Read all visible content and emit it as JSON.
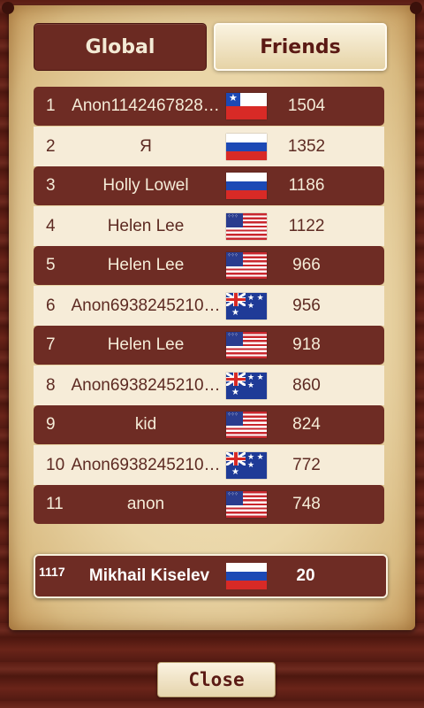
{
  "tabs": {
    "global_label": "Global",
    "friends_label": "Friends",
    "active": "global"
  },
  "leaderboard": [
    {
      "rank": "1",
      "name": "Anon1142467828…",
      "flag": "chile-flag-icon",
      "score": "1504"
    },
    {
      "rank": "2",
      "name": "Я",
      "flag": "russia-flag-icon",
      "score": "1352"
    },
    {
      "rank": "3",
      "name": "Holly Lowel",
      "flag": "russia-flag-icon",
      "score": "1186"
    },
    {
      "rank": "4",
      "name": "Helen Lee",
      "flag": "usa-flag-icon",
      "score": "1122"
    },
    {
      "rank": "5",
      "name": "Helen Lee",
      "flag": "usa-flag-icon",
      "score": "966"
    },
    {
      "rank": "6",
      "name": "Anon6938245210…",
      "flag": "australia-flag-icon",
      "score": "956"
    },
    {
      "rank": "7",
      "name": "Helen Lee",
      "flag": "usa-flag-icon",
      "score": "918"
    },
    {
      "rank": "8",
      "name": "Anon6938245210…",
      "flag": "australia-flag-icon",
      "score": "860"
    },
    {
      "rank": "9",
      "name": "kid",
      "flag": "usa-flag-icon",
      "score": "824"
    },
    {
      "rank": "10",
      "name": "Anon6938245210…",
      "flag": "australia-flag-icon",
      "score": "772"
    },
    {
      "rank": "11",
      "name": "anon",
      "flag": "usa-flag-icon",
      "score": "748"
    }
  ],
  "current_player": {
    "rank": "1117",
    "name": "Mikhail Kiselev",
    "flag": "russia-flag-icon",
    "score": "20"
  },
  "close_label": "Close",
  "colors": {
    "dark_row": "#6e2c24",
    "light_row": "#f6ecd8",
    "parchment": "#ead6a8",
    "wood": "#5b1d14"
  }
}
